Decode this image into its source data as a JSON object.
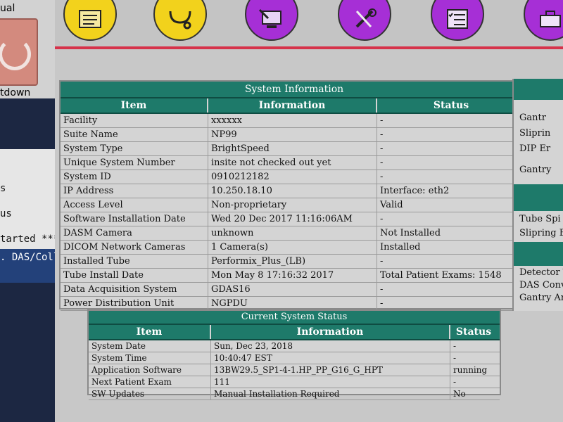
{
  "left_panel": {
    "top_label": "ual",
    "shutdown_label": "tdown",
    "status_lines": [
      "s",
      "us",
      "tarted ****"
    ],
    "das_label": ". DAS/Coll"
  },
  "toolbar_icons": [
    "clipboard-icon",
    "stethoscope-icon",
    "computer-service-icon",
    "tools-icon",
    "checklist-icon",
    "toolbox-icon"
  ],
  "system_information": {
    "title": "System Information",
    "headers": [
      "Item",
      "Information",
      "Status"
    ],
    "rows": [
      [
        "Facility",
        "xxxxxx",
        "-"
      ],
      [
        "Suite Name",
        "NP99",
        "-"
      ],
      [
        "System Type",
        "BrightSpeed",
        "-"
      ],
      [
        "Unique System Number",
        "insite not checked out yet",
        "-"
      ],
      [
        "System ID",
        "0910212182",
        "-"
      ],
      [
        "IP Address",
        "10.250.18.10",
        "Interface: eth2"
      ],
      [
        "Access Level",
        "Non-proprietary",
        "Valid"
      ],
      [
        "Software Installation Date",
        "Wed 20 Dec 2017 11:16:06AM",
        "-"
      ],
      [
        "DASM Camera",
        "unknown",
        "Not Installed"
      ],
      [
        "DICOM Network Cameras",
        "1 Camera(s)",
        "Installed"
      ],
      [
        "Installed Tube",
        "Performix_Plus_(LB)",
        "-"
      ],
      [
        "Tube Install Date",
        "Mon May 8 17:16:32 2017",
        "Total Patient Exams: 1548"
      ],
      [
        "Data Acquisition System",
        "GDAS16",
        "-"
      ],
      [
        "Power Distribution Unit",
        "NGPDU",
        "-"
      ]
    ]
  },
  "current_system_status": {
    "title": "Current System Status",
    "headers": [
      "Item",
      "Information",
      "Status"
    ],
    "rows": [
      [
        "System Date",
        "Sun, Dec 23, 2018",
        "-"
      ],
      [
        "System Time",
        "10:40:47 EST",
        "-"
      ],
      [
        "Application Software",
        "13BW29.5_SP1-4-1.HP_PP_G16_G_HPT",
        "running"
      ],
      [
        "Next Patient Exam",
        "111",
        "-"
      ],
      [
        "SW Updates",
        "Manual Installation Required",
        "No"
      ]
    ]
  },
  "right_panel": {
    "items": [
      "Gantr",
      "Sliprin",
      "DIP Er",
      "Gantry",
      "Tube Spi",
      "Slipring B",
      "Detector T",
      "DAS Conv",
      "Gantry Am"
    ]
  },
  "colors": {
    "header_teal": "#1e7a6a",
    "red_line": "#d6324a",
    "yellow_button": "#f2d21c",
    "purple_button": "#a62fd6"
  }
}
